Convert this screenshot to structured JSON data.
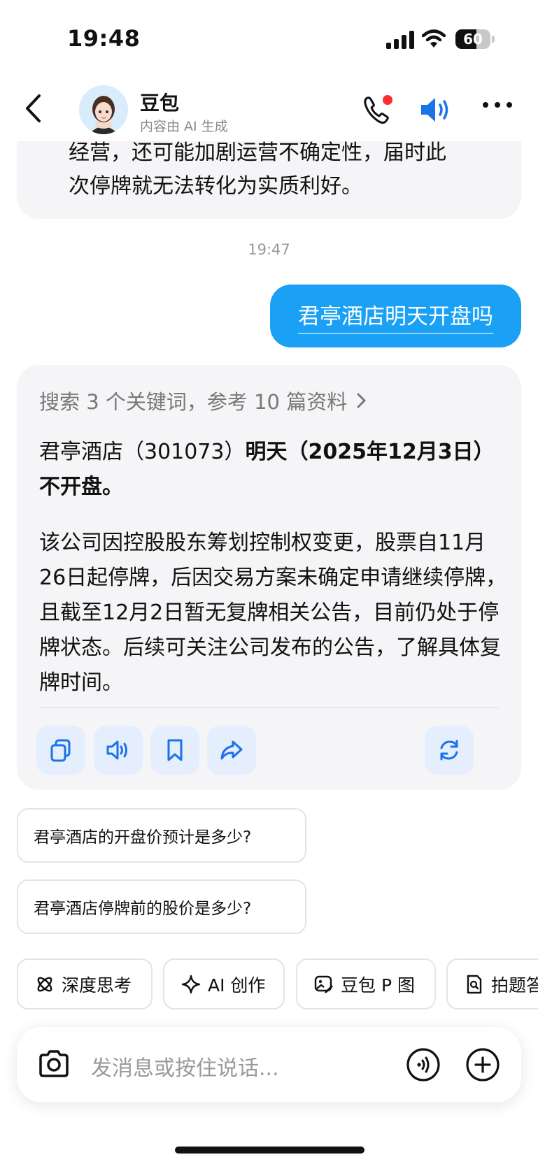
{
  "status_bar": {
    "time": "19:48",
    "battery": "60",
    "battery_fraction": 0.6
  },
  "header": {
    "name": "豆包",
    "subtitle": "内容由 AI 生成"
  },
  "messages": {
    "prev_bot_line1": "经营，还可能加剧运营不确定性，届时此",
    "prev_bot_line2": "次停牌就无法转化为实质利好。",
    "timestamp": "19:47",
    "user_text": "君亭酒店明天开盘吗",
    "search_summary": "搜索 3 个关键词，参考 10 篇资料",
    "answer_p1_plain": "君亭酒店（301073）",
    "answer_p1_bold": "明天（2025年12月3日）不开盘。",
    "answer_p2": "该公司因控股股东筹划控制权变更，股票自11月26日起停牌，后因交易方案未确定申请继续停牌，且截至12月2日暂无复牌相关公告，目前仍处于停牌状态。后续可关注公司发布的公告，了解具体复牌时间。"
  },
  "suggestions": [
    "君亭酒店的开盘价预计是多少?",
    "君亭酒店停牌前的股价是多少?"
  ],
  "chips": [
    "深度思考",
    "AI 创作",
    "豆包 P 图",
    "拍题答疑"
  ],
  "input": {
    "placeholder": "发消息或按住说话..."
  },
  "colors": {
    "accent": "#1aa0f5",
    "action_icon": "#1a73e8",
    "notification_dot": "#ff2d2d"
  }
}
